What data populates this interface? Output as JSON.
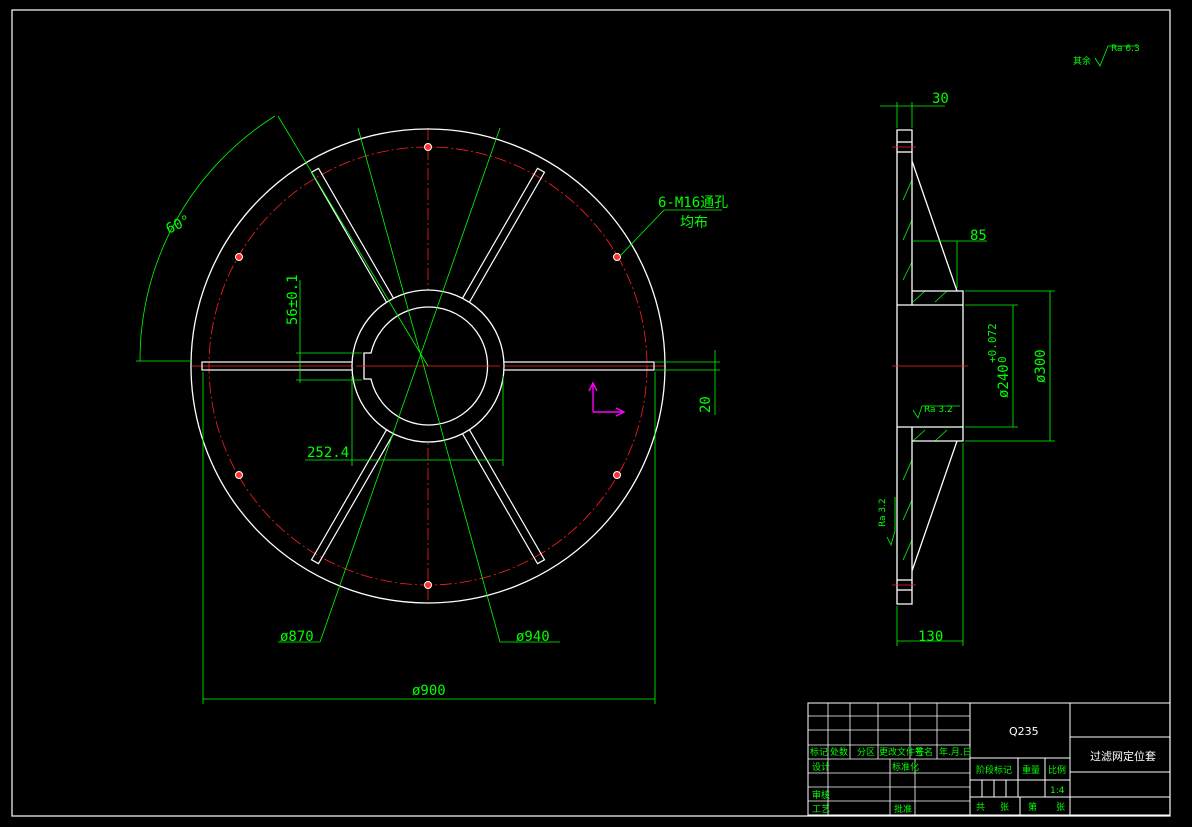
{
  "colors": {
    "background": "#000000",
    "outline": "#ffffff",
    "dimension": "#00ff00",
    "center_line": "#ff0000",
    "ucs": "#ff00ff"
  },
  "front_view": {
    "angle": "60°",
    "holes_note_line1": "6-M16通孔",
    "holes_note_line2": "均布",
    "keyway": "56±0.1",
    "slot_width": "20",
    "slot_offset": "252.4",
    "dia_870": "ø870",
    "dia_940": "ø940",
    "dia_900": "ø900"
  },
  "side_view": {
    "thickness": "30",
    "dim_85": "85",
    "hub_width": "130",
    "bore_dia": "ø240",
    "bore_tol": "+0.072",
    "bore_tol_low": "0",
    "hub_dia": "ø300",
    "ra_hub": "Ra 3.2",
    "ra_face": "Ra 3.2",
    "general_roughness_label": "其余",
    "general_roughness_value": "Ra 6.3"
  },
  "title_block": {
    "material": "Q235",
    "part_name": "过滤网定位套",
    "scale": "1:4",
    "labels": {
      "mark": "标记",
      "count": "处数",
      "zone": "分区",
      "change_doc": "更改文件号",
      "signature": "签名",
      "date": "年.月.日",
      "design": "设计",
      "standardize": "标准化",
      "review": "审核",
      "process": "工艺",
      "approve": "批准",
      "stage_mark": "阶段标记",
      "weight": "重量",
      "scale_label": "比例",
      "total": "共",
      "sheets": "张",
      "page": "第",
      "sheet": "张"
    }
  }
}
